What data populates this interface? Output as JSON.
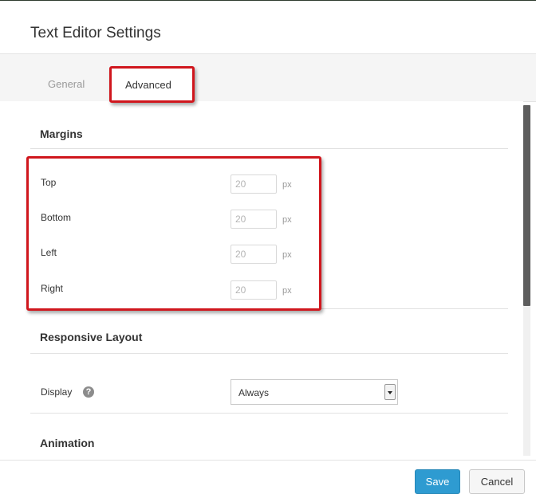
{
  "dialog": {
    "title": "Text Editor Settings"
  },
  "tabs": [
    {
      "label": "General",
      "active": false
    },
    {
      "label": "Advanced",
      "active": true
    }
  ],
  "margins": {
    "heading": "Margins",
    "fields": [
      {
        "label": "Top",
        "value": "20",
        "unit": "px"
      },
      {
        "label": "Bottom",
        "value": "20",
        "unit": "px"
      },
      {
        "label": "Left",
        "value": "20",
        "unit": "px"
      },
      {
        "label": "Right",
        "value": "20",
        "unit": "px"
      }
    ]
  },
  "responsive": {
    "heading": "Responsive Layout",
    "display_label": "Display",
    "display_value": "Always",
    "help_icon": "help-icon"
  },
  "animation": {
    "heading": "Animation"
  },
  "footer": {
    "save_label": "Save",
    "cancel_label": "Cancel"
  },
  "colors": {
    "highlight": "#d0161d",
    "save_button": "#2e9bd1"
  }
}
